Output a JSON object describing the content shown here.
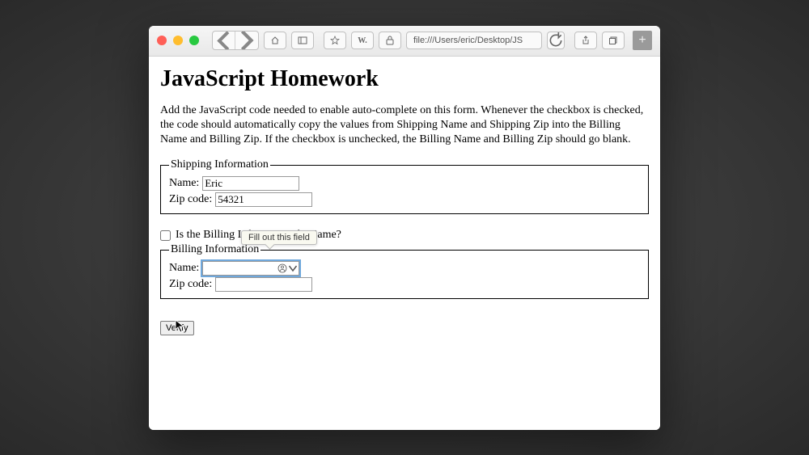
{
  "url": "file:///Users/eric/Desktop/JS",
  "page": {
    "heading": "JavaScript Homework",
    "description": "Add the JavaScript code needed to enable auto-complete on this form. Whenever the checkbox is checked, the code should automatically copy the values from Shipping Name and Shipping Zip into the Billing Name and Billing Zip. If the checkbox is unchecked, the Billing Name and Billing Zip should go blank."
  },
  "shipping": {
    "legend": "Shipping Information",
    "name_label": "Name:",
    "name_value": "Eric",
    "zip_label": "Zip code:",
    "zip_value": "54321"
  },
  "checkbox": {
    "label": "Is the Billing Information the Same?"
  },
  "billing": {
    "legend": "Billing Information",
    "name_label": "Name:",
    "name_value": "",
    "zip_label": "Zip code:",
    "zip_value": ""
  },
  "tooltip": "Fill out this field",
  "verify_label": "Verify"
}
